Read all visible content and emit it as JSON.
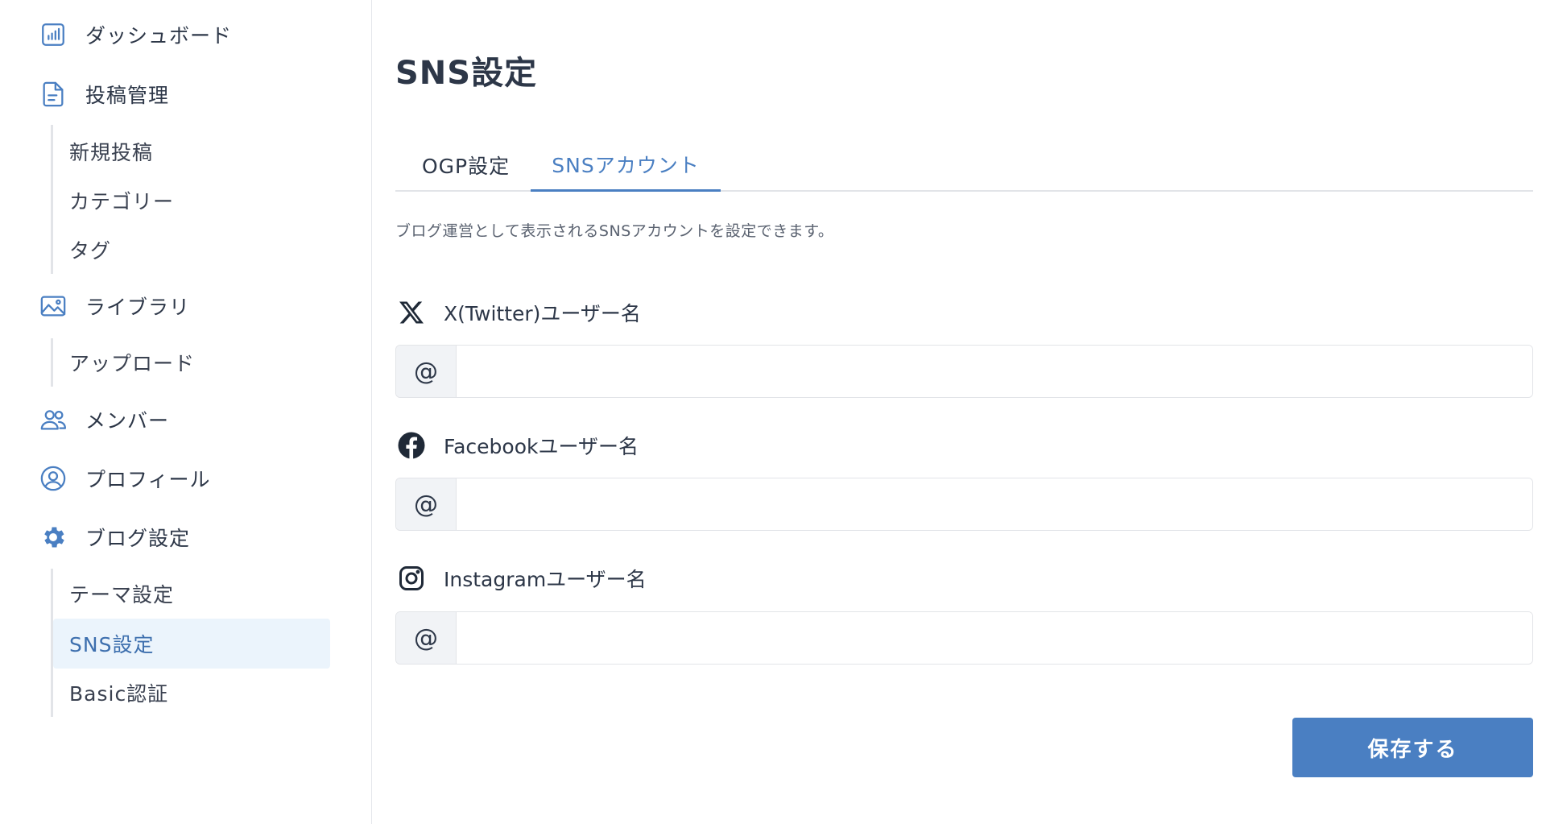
{
  "sidebar": {
    "dashboard": "ダッシュボード",
    "posts": "投稿管理",
    "posts_sub": [
      "新規投稿",
      "カテゴリー",
      "タグ"
    ],
    "library": "ライブラリ",
    "library_sub": [
      "アップロード"
    ],
    "members": "メンバー",
    "profile": "プロフィール",
    "blog_settings": "ブログ設定",
    "blog_settings_sub": [
      "テーマ設定",
      "SNS設定",
      "Basic認証"
    ],
    "active_item": "SNS設定"
  },
  "page": {
    "title": "SNS設定",
    "tabs": [
      "OGP設定",
      "SNSアカウント"
    ],
    "active_tab": "SNSアカウント",
    "description": "ブログ運営として表示されるSNSアカウントを設定できます。"
  },
  "fields": [
    {
      "label": "X(Twitter)ユーザー名",
      "icon": "x-twitter-icon",
      "prefix": "@",
      "value": "",
      "placeholder": ""
    },
    {
      "label": "Facebookユーザー名",
      "icon": "facebook-icon",
      "prefix": "@",
      "value": "",
      "placeholder": ""
    },
    {
      "label": "Instagramユーザー名",
      "icon": "instagram-icon",
      "prefix": "@",
      "value": "",
      "placeholder": ""
    }
  ],
  "save_label": "保存する",
  "colors": {
    "accent": "#4a7fc2",
    "active_bg": "#ebf4fc",
    "text": "#2d3748"
  }
}
